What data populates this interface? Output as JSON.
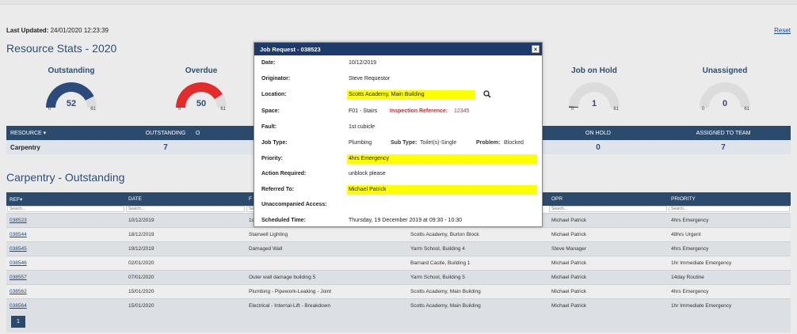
{
  "header": {
    "last_updated_label": "Last Updated:",
    "last_updated_value": "24/01/2020 12:23:39",
    "reset_label": "Reset",
    "stats_title": "Resource Stats - 2020"
  },
  "gauges": [
    {
      "title": "Outstanding",
      "value": "52",
      "min": "0",
      "max": "61",
      "fraction": 0.85,
      "color": "#2c4a7b"
    },
    {
      "title": "Overdue",
      "value": "50",
      "min": "0",
      "max": "61",
      "fraction": 0.82,
      "color": "#e32b2b"
    },
    {
      "title": "Job on Hold",
      "value": "1",
      "min": "0",
      "max": "61",
      "fraction": 0.016,
      "color": "#2c4a7b"
    },
    {
      "title": "Unassigned",
      "value": "0",
      "min": "0",
      "max": "61",
      "fraction": 0.0,
      "color": "#2c4a7b"
    }
  ],
  "summary": {
    "headers": [
      "RESOURCE",
      "OUTSTANDING",
      "O",
      "ON HOLD",
      "ASSIGNED TO TEAM"
    ],
    "row": {
      "resource": "Carpentry",
      "outstanding": "7",
      "on_hold": "0",
      "assigned": "7"
    }
  },
  "carpentry_title": "Carpentry - Outstanding",
  "jobs": {
    "headers": [
      "REF",
      "DATE",
      "F",
      "",
      "OPR",
      "PRIORITY"
    ],
    "search_placeholder": "Search...",
    "rows": [
      {
        "ref": "038523",
        "date": "10/12/2019",
        "fault": "1s",
        "location": "",
        "opr": "Michael Patrick",
        "priority": "4hrs Emergency",
        "pclass": "green"
      },
      {
        "ref": "038544",
        "date": "18/12/2019",
        "fault": "Stairwell Lighting",
        "location": "Scotts Academy, Burton Block",
        "opr": "Michael Patrick",
        "priority": "48hrs Urgent",
        "pclass": "blue"
      },
      {
        "ref": "038545",
        "date": "19/12/2019",
        "fault": "Damaged Wall",
        "location": "Yarm School, Building 4",
        "opr": "Steve Manager",
        "priority": "4hrs Emergency",
        "pclass": "green"
      },
      {
        "ref": "038546",
        "date": "02/01/2020",
        "fault": "",
        "location": "Barnard Castle, Building 1",
        "opr": "Michael Patrick",
        "priority": "1hr Immediate Emergency",
        "pclass": "red"
      },
      {
        "ref": "038557",
        "date": "07/01/2020",
        "fault": "Outer wall damage building 5",
        "location": "Yarm School, Building 5",
        "opr": "Michael Patrick",
        "priority": "14day Routine",
        "pclass": ""
      },
      {
        "ref": "038562",
        "date": "15/01/2020",
        "fault": "Plumbing - Pipework-Leaking - Joint",
        "location": "Scotts Academy, Main Building",
        "opr": "Michael Patrick",
        "priority": "4hrs Emergency",
        "pclass": "green"
      },
      {
        "ref": "038564",
        "date": "15/01/2020",
        "fault": "Electrical - Internal-Lift - Breakdown",
        "location": "Scotts Academy, Main Building",
        "opr": "Michael Patrick",
        "priority": "1hr Immediate Emergency",
        "pclass": "red"
      }
    ]
  },
  "pager": {
    "page": "1"
  },
  "modal": {
    "title": "Job Request - 038523",
    "close": "×",
    "date_label": "Date:",
    "date": "10/12/2019",
    "originator_label": "Originator:",
    "originator": "Steve Requestor",
    "location_label": "Location:",
    "location": "Scotts Academy, Main Building",
    "space_label": "Space:",
    "space": "F01 - Stairs",
    "inspection_label": "Inspection Reference:",
    "inspection": "12345",
    "fault_label": "Fault:",
    "fault": "1st cubicle",
    "jobtype_label": "Job Type:",
    "jobtype": "Plumbing",
    "subtype_label": "Sub Type:",
    "subtype": "Toilet(s)-Single",
    "problem_label": "Problem:",
    "problem": "Blocked",
    "priority_label": "Priority:",
    "priority": "4hrs Emergency",
    "action_label": "Action Required:",
    "action": "unblock please",
    "referred_label": "Referred To:",
    "referred": "Michael Patrick",
    "unaccompanied_label": "Unaccompanied Access:",
    "scheduled_label": "Scheduled Time:",
    "scheduled": "Thursday, 19 December 2019 at 09:30 - 10:30"
  }
}
